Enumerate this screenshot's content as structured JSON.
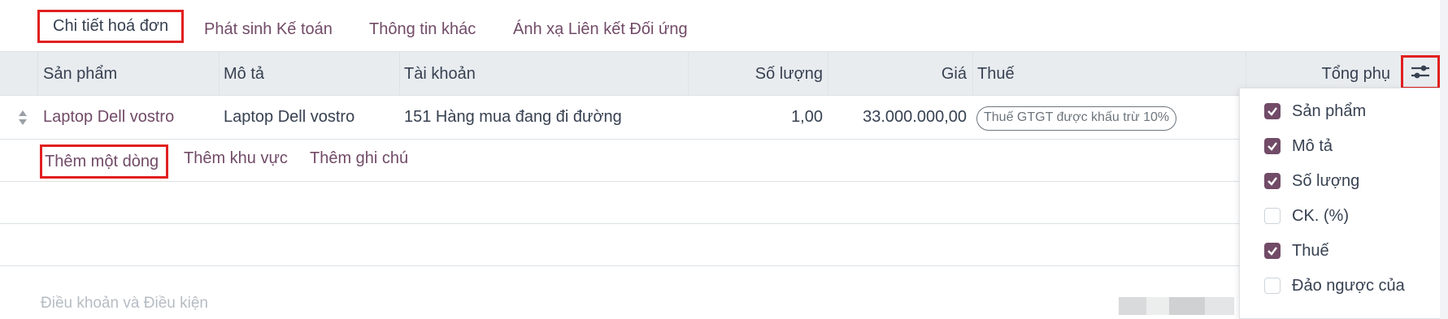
{
  "tabs": [
    {
      "label": "Chi tiết hoá đơn"
    },
    {
      "label": "Phát sinh Kế toán"
    },
    {
      "label": "Thông tin khác"
    },
    {
      "label": "Ánh xạ Liên kết Đối ứng"
    }
  ],
  "table": {
    "headers": {
      "product": "Sản phẩm",
      "description": "Mô tả",
      "account": "Tài khoản",
      "quantity": "Số lượng",
      "price": "Giá",
      "tax": "Thuế",
      "subtotal": "Tổng phụ"
    },
    "rows": [
      {
        "product": "Laptop Dell vostro",
        "description": "Laptop Dell vostro",
        "account": "151 Hàng mua đang đi đường",
        "quantity": "1,00",
        "price": "33.000.000,00",
        "tax": "Thuế GTGT được khấu trừ 10%"
      }
    ]
  },
  "actions": {
    "add_line": "Thêm một dòng",
    "add_section": "Thêm khu vực",
    "add_note": "Thêm ghi chú"
  },
  "terms_placeholder": "Điều khoản và Điều kiện",
  "column_options": [
    {
      "label": "Sản phẩm",
      "checked": true
    },
    {
      "label": "Mô tả",
      "checked": true
    },
    {
      "label": "Số lượng",
      "checked": true
    },
    {
      "label": "CK. (%)",
      "checked": false
    },
    {
      "label": "Thuế",
      "checked": true
    },
    {
      "label": "Đảo ngược của",
      "checked": false
    }
  ],
  "icons": {
    "settings": "sliders-icon",
    "handle": "drag-handle-icon",
    "check": "checkmark-icon"
  },
  "colors": {
    "accent": "#714B67",
    "highlight_border": "#e0201f",
    "header_bg": "#e9ecef"
  }
}
